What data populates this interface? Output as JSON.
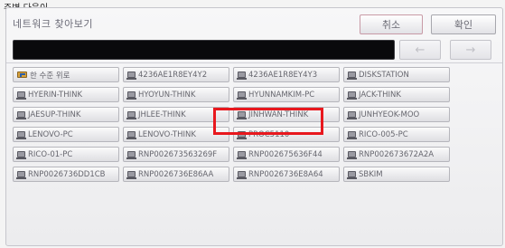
{
  "caption": "주변 다음이",
  "dialog": {
    "title": "네트워크 찾아보기",
    "cancel_label": "취소",
    "ok_label": "확인",
    "prev_arrow": "←",
    "next_arrow": "→"
  },
  "computers": [
    {
      "label": "한 수준 위로",
      "icon": "up-folder-icon"
    },
    {
      "label": "4236AE1R8EY4Y2",
      "icon": "computer-icon"
    },
    {
      "label": "4236AE1R8EY4Y3",
      "icon": "computer-icon"
    },
    {
      "label": "DISKSTATION",
      "icon": "computer-icon"
    },
    {
      "label": "HYERIN-THINK",
      "icon": "computer-icon"
    },
    {
      "label": "HYOYUN-THINK",
      "icon": "computer-icon"
    },
    {
      "label": "HYUNNAMKIM-PC",
      "icon": "computer-icon"
    },
    {
      "label": "JACK-THINK",
      "icon": "computer-icon"
    },
    {
      "label": "JAESUP-THINK",
      "icon": "computer-icon"
    },
    {
      "label": "JHLEE-THINK",
      "icon": "computer-icon"
    },
    {
      "label": "JINHWAN-THINK",
      "icon": "computer-icon"
    },
    {
      "label": "JUNHYEOK-MOO",
      "icon": "computer-icon"
    },
    {
      "label": "LENOVO-PC",
      "icon": "computer-icon"
    },
    {
      "label": "LENOVO-THINK",
      "icon": "computer-icon"
    },
    {
      "label": "PROC5110",
      "icon": "computer-icon"
    },
    {
      "label": "RICO-005-PC",
      "icon": "computer-icon"
    },
    {
      "label": "RICO-01-PC",
      "icon": "computer-icon"
    },
    {
      "label": "RNP002673563269F",
      "icon": "computer-icon"
    },
    {
      "label": "RNP002675636F44",
      "icon": "computer-icon"
    },
    {
      "label": "RNP002673672A2A",
      "icon": "computer-icon"
    },
    {
      "label": "RNP0026736DD1CB",
      "icon": "computer-icon"
    },
    {
      "label": "RNP0026736E86AA",
      "icon": "computer-icon"
    },
    {
      "label": "RNP0026736E8A64",
      "icon": "computer-icon"
    },
    {
      "label": "SBKIM",
      "icon": "computer-icon"
    }
  ],
  "highlight_color": "#e8181e"
}
